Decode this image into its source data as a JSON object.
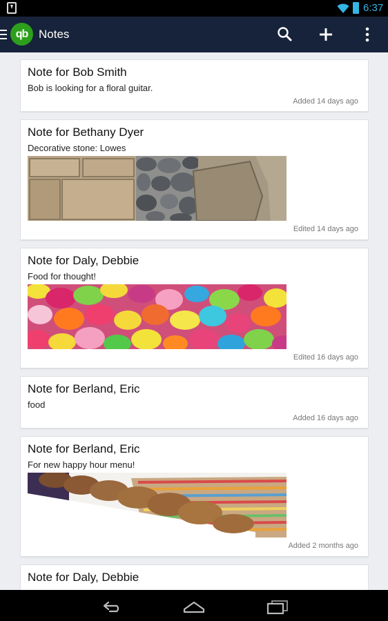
{
  "status_bar": {
    "time": "6:37"
  },
  "app_bar": {
    "logo_text": "qb",
    "title": "Notes",
    "icons": {
      "menu": "hamburger-icon",
      "search": "search-icon",
      "add": "plus-icon",
      "more": "overflow-menu-icon"
    }
  },
  "notes": [
    {
      "title": "Note for Bob Smith",
      "body": "Bob is looking for a floral guitar.",
      "meta": "Added 14 days ago",
      "image": null
    },
    {
      "title": "Note for Bethany Dyer",
      "body": "Decorative stone: Lowes",
      "meta": "Edited 14 days ago",
      "image": "stones"
    },
    {
      "title": "Note for Daly, Debbie",
      "body": "Food for thought!",
      "meta": "Edited 16 days ago",
      "image": "jellybeans"
    },
    {
      "title": "Note for Berland, Eric",
      "body": "food",
      "meta": "Added 16 days ago",
      "image": null
    },
    {
      "title": "Note for Berland, Eric",
      "body": "For new happy hour menu!",
      "meta": "Added 2 months ago",
      "image": "cookies"
    },
    {
      "title": "Note for Daly, Debbie",
      "body": "",
      "meta": "",
      "image": null
    }
  ],
  "colors": {
    "app_bar": "#17233a",
    "brand_green": "#2ca01c",
    "status_accent": "#33b5e5"
  }
}
